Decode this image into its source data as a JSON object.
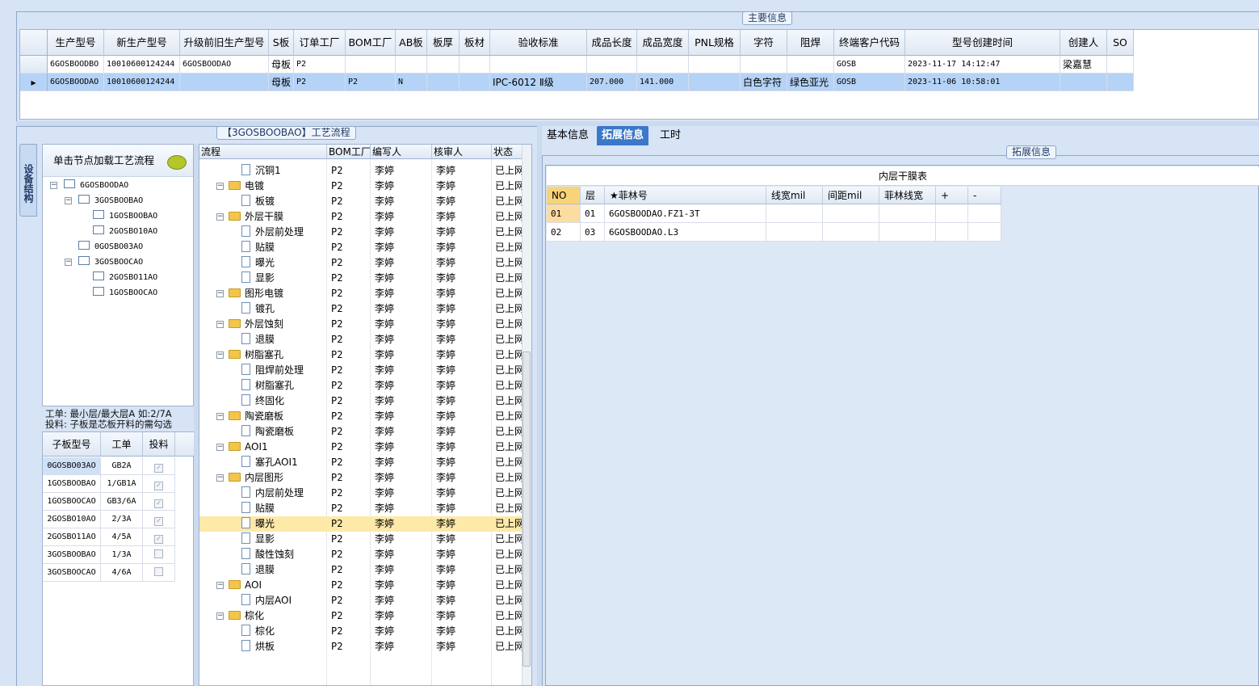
{
  "main_info": {
    "title": "主要信息",
    "columns": [
      "生产型号",
      "新生产型号",
      "升级前旧生产型号",
      "S板",
      "订单工厂",
      "BOM工厂",
      "AB板",
      "板厚",
      "板材",
      "验收标准",
      "成品长度",
      "成品宽度",
      "PNL规格",
      "字符",
      "阻焊",
      "终端客户代码",
      "型号创建时间",
      "创建人",
      "SO"
    ],
    "rows": [
      [
        "6GOSBOODBO",
        "10010600124244",
        "6GOSBOODAO",
        "母板",
        "P2",
        "",
        "",
        "",
        "",
        "",
        "",
        "",
        "",
        "",
        "",
        "GOSB",
        "2023-11-17 14:12:47",
        "梁嘉慧",
        ""
      ],
      [
        "6GOSBOODAO",
        "10010600124244",
        "",
        "母板",
        "P2",
        "P2",
        "N",
        "",
        "",
        "IPC-6012 Ⅱ级",
        "207.000",
        "141.000",
        "",
        "白色字符",
        "绿色亚光",
        "GOSB",
        "2023-11-06 10:58:01",
        "",
        ""
      ]
    ],
    "selected_row": 1,
    "row_pointer": "▸"
  },
  "left_tab": {
    "label": "设备结构"
  },
  "tree": {
    "header": "单击节点加载工艺流程",
    "nodes": [
      {
        "label": "6GOSBOODAO",
        "level": 0,
        "expanded": true
      },
      {
        "label": "3GOSBOOBAO",
        "level": 1,
        "expanded": true
      },
      {
        "label": "1GOSBOOBAO",
        "level": 2
      },
      {
        "label": "2GOSBO10AO",
        "level": 2
      },
      {
        "label": "0GOSBO03AO",
        "level": 1
      },
      {
        "label": "3GOSBOOCAO",
        "level": 1,
        "expanded": true
      },
      {
        "label": "2GOSBO11AO",
        "level": 2
      },
      {
        "label": "1GOSBOOCAO",
        "level": 2
      }
    ]
  },
  "note": {
    "line1": "工单: 最小层/最大层A 如:2/7A",
    "line2": "投料: 子板是芯板开料的需勾选"
  },
  "subboard": {
    "columns": [
      "子板型号",
      "工单",
      "投料"
    ],
    "rows": [
      {
        "model": "0GOSBO03AO",
        "order": "GB2A",
        "feed": true
      },
      {
        "model": "1GOSBOOBAO",
        "order": "1/GB1A",
        "feed": true
      },
      {
        "model": "1GOSBOOCAO",
        "order": "GB3/6A",
        "feed": true
      },
      {
        "model": "2GOSBO10AO",
        "order": "2/3A",
        "feed": true
      },
      {
        "model": "2GOSBO11AO",
        "order": "4/5A",
        "feed": true
      },
      {
        "model": "3GOSBOOBAO",
        "order": "1/3A",
        "feed": false
      },
      {
        "model": "3GOSBOOCAO",
        "order": "4/6A",
        "feed": false
      }
    ]
  },
  "flow": {
    "title": "【3GOSBOOBAO】工艺流程",
    "columns": [
      "流程",
      "BOM工厂",
      "编写人",
      "核审人",
      "状态"
    ],
    "rows": [
      {
        "name": "沉铜1",
        "type": "doc"
      },
      {
        "name": "电镀",
        "type": "folder"
      },
      {
        "name": "板镀",
        "type": "doc"
      },
      {
        "name": "外层干膜",
        "type": "folder"
      },
      {
        "name": "外层前处理",
        "type": "doc"
      },
      {
        "name": "贴膜",
        "type": "doc"
      },
      {
        "name": "曝光",
        "type": "doc"
      },
      {
        "name": "显影",
        "type": "doc"
      },
      {
        "name": "图形电镀",
        "type": "folder"
      },
      {
        "name": "镀孔",
        "type": "doc"
      },
      {
        "name": "外层蚀刻",
        "type": "folder"
      },
      {
        "name": "退膜",
        "type": "doc"
      },
      {
        "name": "树脂塞孔",
        "type": "folder"
      },
      {
        "name": "阻焊前处理",
        "type": "doc"
      },
      {
        "name": "树脂塞孔",
        "type": "doc"
      },
      {
        "name": "终固化",
        "type": "doc"
      },
      {
        "name": "陶瓷磨板",
        "type": "folder"
      },
      {
        "name": "陶瓷磨板",
        "type": "doc"
      },
      {
        "name": "AOI1",
        "type": "folder"
      },
      {
        "name": "塞孔AOI1",
        "type": "doc"
      },
      {
        "name": "内层图形",
        "type": "folder"
      },
      {
        "name": "内层前处理",
        "type": "doc"
      },
      {
        "name": "贴膜",
        "type": "doc"
      },
      {
        "name": "曝光",
        "type": "doc",
        "selected": true
      },
      {
        "name": "显影",
        "type": "doc"
      },
      {
        "name": "酸性蚀刻",
        "type": "doc"
      },
      {
        "name": "退膜",
        "type": "doc"
      },
      {
        "name": "AOI",
        "type": "folder"
      },
      {
        "name": "内层AOI",
        "type": "doc"
      },
      {
        "name": "棕化",
        "type": "folder"
      },
      {
        "name": "棕化",
        "type": "doc"
      },
      {
        "name": "烘板",
        "type": "doc"
      }
    ],
    "factory": "P2",
    "writer": "李婷",
    "reviewer": "李婷",
    "status": "已上网"
  },
  "tabs": [
    "基本信息",
    "拓展信息",
    "工时"
  ],
  "active_tab": 1,
  "ext": {
    "group_title": "拓展信息",
    "table_title": "内层干膜表",
    "columns": [
      "NO",
      "层",
      "★菲林号",
      "线宽mil",
      "间距mil",
      "菲林线宽",
      "+",
      "-"
    ],
    "rows": [
      [
        "01",
        "01",
        "6GOSBOODAO.FZ1-3T",
        "",
        "",
        "",
        "",
        ""
      ],
      [
        "02",
        "03",
        "6GOSBOODAO.L3",
        "",
        "",
        "",
        "",
        ""
      ]
    ]
  }
}
